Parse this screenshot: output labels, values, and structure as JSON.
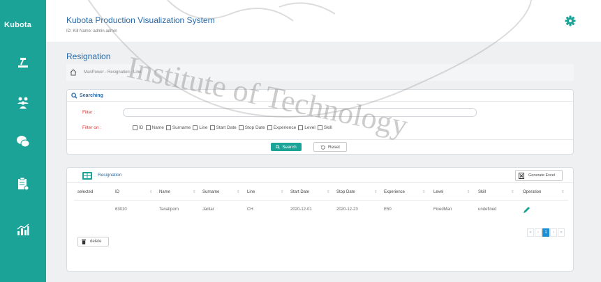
{
  "sidebar": {
    "logo": "Kubota",
    "items": [
      {
        "icon": "production-line-icon"
      },
      {
        "icon": "manpower-icon"
      },
      {
        "icon": "chat-icon"
      },
      {
        "icon": "clipboard-icon"
      },
      {
        "icon": "chart-icon"
      }
    ]
  },
  "header": {
    "title": "Kubota Production Visualization System",
    "user_info": "ID: Kill Name: admin admin",
    "settings_icon": "gear-icon"
  },
  "page": {
    "title": "Resignation",
    "breadcrumb": "ManPower - Resignation - Line"
  },
  "search": {
    "panel_title": "Searching",
    "filter_label": "Filter :",
    "filter_value": "",
    "filter_on_label": "Filter on :",
    "options": [
      "ID",
      "Name",
      "Surname",
      "Line",
      "Start Date",
      "Stop Date",
      "Experience",
      "Level",
      "Skill"
    ],
    "search_button": "Search",
    "reset_button": "Reset"
  },
  "table": {
    "title": "Resignation",
    "excel_button": "Generate Excel",
    "columns": [
      "selected",
      "ID",
      "Name",
      "Surname",
      "Line",
      "Start Date",
      "Stop Date",
      "Experience",
      "Level",
      "Skill",
      "Operation"
    ],
    "rows": [
      {
        "id": "63010",
        "name": "Tanatiporn",
        "surname": "Jantar",
        "line": "CH",
        "start_date": "2020-12-01",
        "stop_date": "2020-12-23",
        "experience": "E50",
        "level": "FixedMan",
        "skill": "undefined"
      }
    ],
    "delete_button": "delete",
    "pagination": {
      "first": "«",
      "prev": "‹",
      "current": "1",
      "next": "›",
      "last": "»"
    }
  },
  "watermark": {
    "line1": "Institute of Technology"
  },
  "colors": {
    "accent": "#1aa396",
    "title_blue": "#2a6aa8",
    "pager_active": "#1b8fd6",
    "filter_label": "#dd3333"
  }
}
